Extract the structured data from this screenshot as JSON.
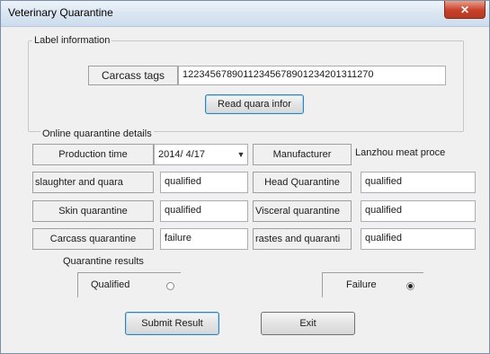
{
  "window": {
    "title": "Veterinary Quarantine",
    "close_label": "✕"
  },
  "label_info": {
    "group_title": "Label information",
    "carcass_tags_label": "Carcass tags",
    "carcass_tags_value": "12234567890112345678901234201311270",
    "read_button": "Read quara infor"
  },
  "online": {
    "group_title": "Online quarantine details",
    "production_time_label": "Production time",
    "production_time_value": "2014/ 4/17",
    "manufacturer_label": "Manufacturer",
    "manufacturer_value": "Lanzhou meat proce",
    "slaughter_label": "slaughter and quara",
    "slaughter_value": "qualified",
    "head_label": "Head Quarantine",
    "head_value": "qualified",
    "skin_label": "Skin quarantine",
    "skin_value": "qualified",
    "visceral_label": "Visceral quarantine",
    "visceral_value": "qualified",
    "carcass_label": "Carcass quarantine",
    "carcass_value": "failure",
    "wastes_label": "rastes and quaranti",
    "wastes_value": "qualified"
  },
  "results": {
    "group_title": "Quarantine results",
    "qualified_label": "Qualified",
    "qualified_checked": false,
    "failure_label": "Failure",
    "failure_checked": true
  },
  "buttons": {
    "submit": "Submit Result",
    "exit": "Exit"
  }
}
